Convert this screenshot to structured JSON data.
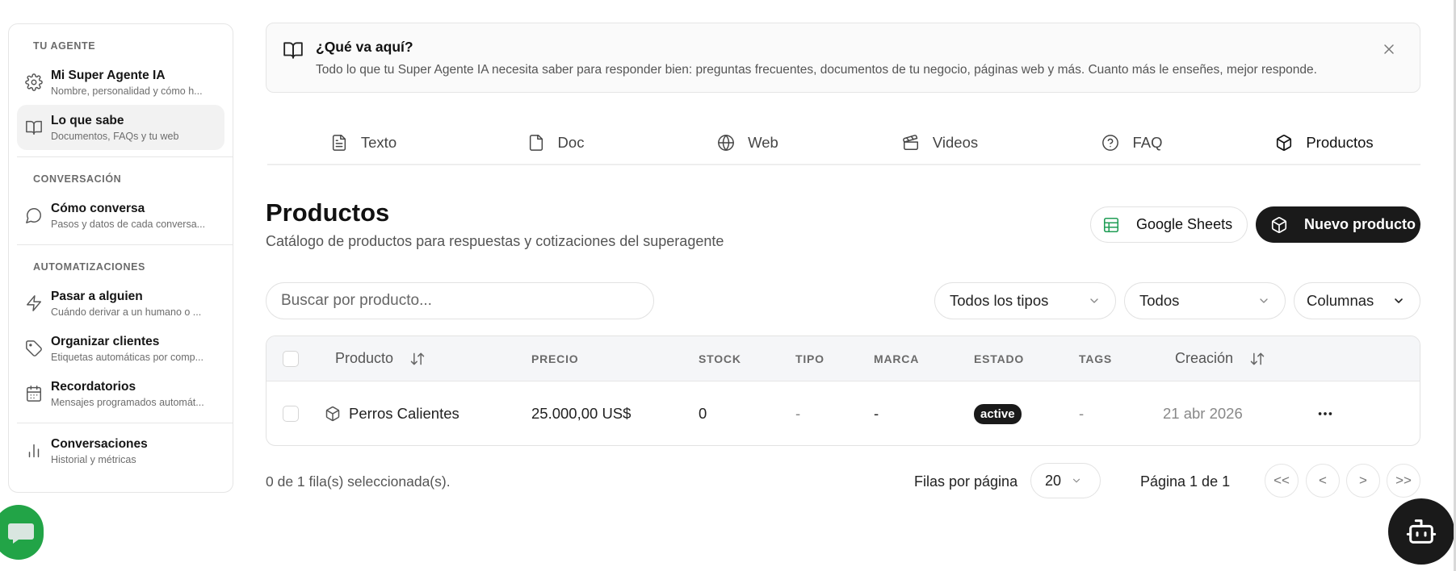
{
  "sidebar": {
    "sections": [
      {
        "title": "TU AGENTE",
        "items": [
          {
            "label": "Mi Super Agente IA",
            "sub": "Nombre, personalidad y cómo h...",
            "icon": "gear-icon"
          },
          {
            "label": "Lo que sabe",
            "sub": "Documentos, FAQs y tu web",
            "icon": "book-icon",
            "active": true
          }
        ]
      },
      {
        "title": "CONVERSACIÓN",
        "items": [
          {
            "label": "Cómo conversa",
            "sub": "Pasos y datos de cada conversa...",
            "icon": "chat-bubble-icon"
          }
        ]
      },
      {
        "title": "AUTOMATIZACIONES",
        "items": [
          {
            "label": "Pasar a alguien",
            "sub": "Cuándo derivar a un humano o ...",
            "icon": "lightning-icon"
          },
          {
            "label": "Organizar clientes",
            "sub": "Etiquetas automáticas por comp...",
            "icon": "tag-icon"
          },
          {
            "label": "Recordatorios",
            "sub": "Mensajes programados automát...",
            "icon": "calendar-icon"
          }
        ]
      },
      {
        "title": "",
        "items": [
          {
            "label": "Conversaciones",
            "sub": "Historial y métricas",
            "icon": "bar-chart-icon"
          }
        ]
      }
    ]
  },
  "banner": {
    "title": "¿Qué va aquí?",
    "text": "Todo lo que tu Super Agente IA necesita saber para responder bien: preguntas frecuentes, documentos de tu negocio, páginas web y más. Cuanto más le enseñes, mejor responde."
  },
  "tabs": [
    {
      "label": "Texto",
      "icon": "text-file-icon"
    },
    {
      "label": "Doc",
      "icon": "document-icon"
    },
    {
      "label": "Web",
      "icon": "globe-icon"
    },
    {
      "label": "Videos",
      "icon": "clapperboard-icon"
    },
    {
      "label": "FAQ",
      "icon": "help-circle-icon"
    },
    {
      "label": "Productos",
      "icon": "package-icon",
      "active": true
    }
  ],
  "header": {
    "title": "Productos",
    "subtitle": "Catálogo de productos para respuestas y cotizaciones del superagente",
    "sheets_label": "Google Sheets",
    "new_label": "Nuevo producto"
  },
  "filters": {
    "search_placeholder": "Buscar por producto...",
    "type_value": "Todos los tipos",
    "status_value": "Todos",
    "columns_label": "Columnas"
  },
  "table": {
    "headers": {
      "product": "Producto",
      "price": "PRECIO",
      "stock": "STOCK",
      "type": "TIPO",
      "brand": "MARCA",
      "status": "ESTADO",
      "tags": "TAGS",
      "created": "Creación"
    },
    "rows": [
      {
        "product": "Perros Calientes",
        "price": "25.000,00 US$",
        "stock": "0",
        "type": "-",
        "brand": "-",
        "status": "active",
        "tags": "-",
        "created": "21 abr 2026"
      }
    ]
  },
  "footer": {
    "selected": "0 de 1 fila(s) seleccionada(s).",
    "rows_label": "Filas por página",
    "rows_value": "20",
    "page_label": "Página 1 de 1",
    "first": "<<",
    "prev": "<",
    "next": ">",
    "last": ">>"
  },
  "colors": {
    "accent": "#1a1a1a",
    "chat_fab": "#22a447",
    "sheets_icon": "#1f9d55"
  }
}
